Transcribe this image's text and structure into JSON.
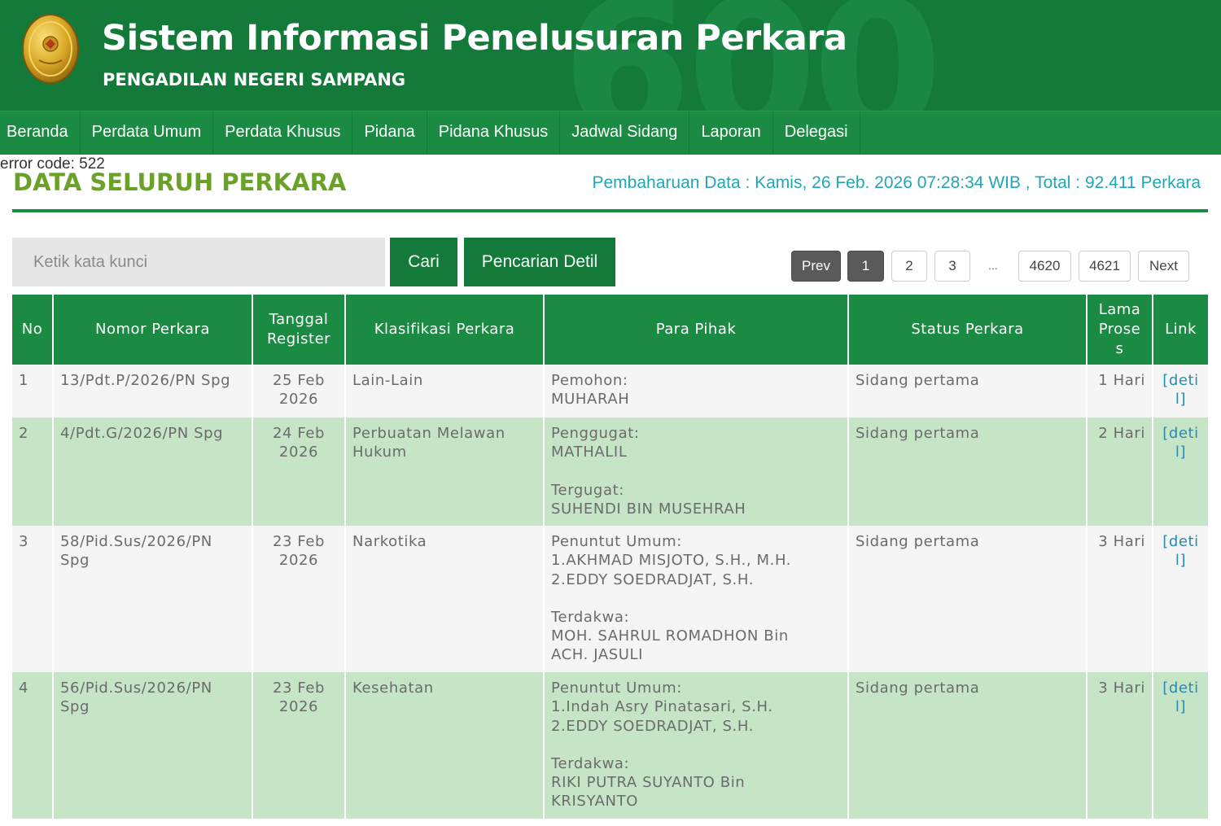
{
  "header": {
    "title": "Sistem Informasi Penelusuran Perkara",
    "subtitle": "PENGADILAN NEGERI SAMPANG",
    "watermark": "600",
    "colors": {
      "header_bg": "#137a3a",
      "nav_bg": "#1b8a43",
      "title_accent": "#6aa229",
      "info_text": "#20a6b8",
      "row_alt": "#c6e5c7"
    }
  },
  "nav": {
    "items": [
      "Beranda",
      "Perdata Umum",
      "Perdata Khusus",
      "Pidana",
      "Pidana Khusus",
      "Jadwal Sidang",
      "Laporan",
      "Delegasi"
    ]
  },
  "error_code": "error code: 522",
  "page_title": "DATA SELURUH PERKARA",
  "update_info": "Pembaharuan Data : Kamis, 26 Feb. 2026 07:28:34 WIB , Total : 92.411 Perkara",
  "search": {
    "placeholder": "Ketik kata kunci",
    "value": "",
    "search_button": "Cari",
    "detail_button": "Pencarian Detil"
  },
  "pagination": {
    "prev": "Prev",
    "pages": [
      "1",
      "2",
      "3"
    ],
    "ellipsis": "...",
    "last_pages": [
      "4620",
      "4621"
    ],
    "next": "Next",
    "current": "1"
  },
  "table": {
    "headers": {
      "no": "No",
      "nomor": "Nomor Perkara",
      "tanggal_1": "Tanggal",
      "tanggal_2": "Register",
      "klasifikasi": "Klasifikasi Perkara",
      "pihak": "Para Pihak",
      "status": "Status Perkara",
      "lama_1": "Lama",
      "lama_2": "Prose",
      "lama_3": "s",
      "link": "Link"
    },
    "rows": [
      {
        "no": "1",
        "nomor": "13/Pdt.P/2026/PN Spg",
        "tanggal_1": "25 Feb",
        "tanggal_2": "2026",
        "klasifikasi": "Lain-Lain",
        "pihak": {
          "role_1": "Pemohon:",
          "names_1": [
            "MUHARAH"
          ]
        },
        "status": "Sidang pertama",
        "lama": "1 Hari",
        "link_1": "[deti",
        "link_2": "l]"
      },
      {
        "no": "2",
        "nomor": "4/Pdt.G/2026/PN Spg",
        "tanggal_1": "24 Feb",
        "tanggal_2": "2026",
        "klasifikasi_1": "Perbuatan Melawan",
        "klasifikasi_2": "Hukum",
        "pihak": {
          "role_1": "Penggugat:",
          "names_1": [
            "MATHALIL"
          ],
          "role_2": "Tergugat:",
          "names_2": [
            "SUHENDI BIN MUSEHRAH"
          ]
        },
        "status": "Sidang pertama",
        "lama": "2 Hari",
        "link_1": "[deti",
        "link_2": "l]"
      },
      {
        "no": "3",
        "nomor_1": "58/Pid.Sus/2026/PN",
        "nomor_2": "Spg",
        "tanggal_1": "23 Feb",
        "tanggal_2": "2026",
        "klasifikasi": "Narkotika",
        "pihak": {
          "role_1": "Penuntut Umum:",
          "names_1": [
            "1.AKHMAD MISJOTO, S.H., M.H.",
            "2.EDDY SOEDRADJAT, S.H."
          ],
          "role_2": "Terdakwa:",
          "names_2": [
            "MOH. SAHRUL ROMADHON Bin",
            "ACH. JASULI"
          ]
        },
        "status": "Sidang pertama",
        "lama": "3 Hari",
        "link_1": "[deti",
        "link_2": "l]"
      },
      {
        "no": "4",
        "nomor_1": "56/Pid.Sus/2026/PN",
        "nomor_2": "Spg",
        "tanggal_1": "23 Feb",
        "tanggal_2": "2026",
        "klasifikasi": "Kesehatan",
        "pihak": {
          "role_1": "Penuntut Umum:",
          "names_1": [
            "1.Indah Asry Pinatasari, S.H.",
            "2.EDDY SOEDRADJAT, S.H."
          ],
          "role_2": "Terdakwa:",
          "names_2": [
            "RIKI PUTRA SUYANTO Bin",
            "KRISYANTO"
          ]
        },
        "status": "Sidang pertama",
        "lama": "3 Hari",
        "link_1": "[deti",
        "link_2": "l]"
      }
    ]
  }
}
